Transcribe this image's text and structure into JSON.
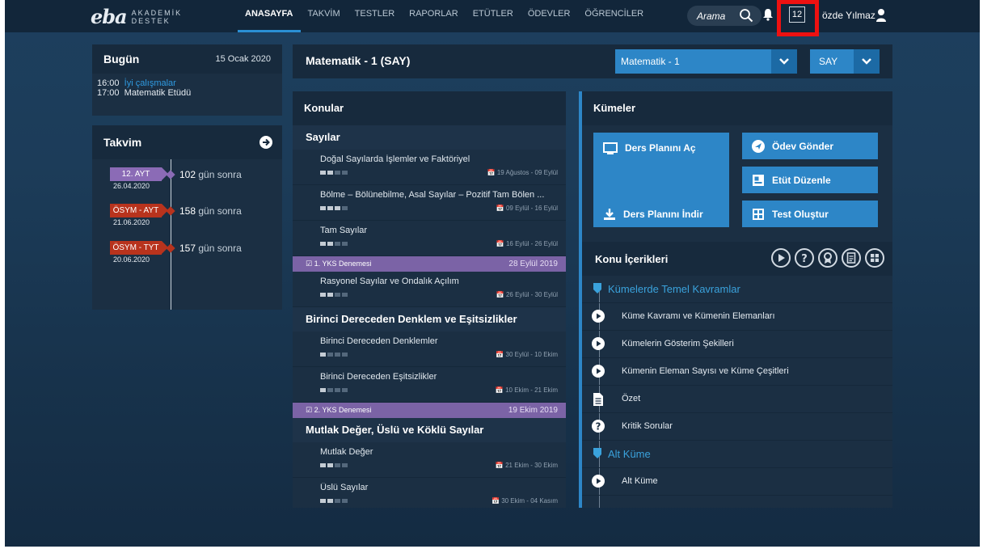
{
  "brand": {
    "mark": "eba",
    "line1": "AKADEMİK",
    "line2": "DESTEK"
  },
  "nav": [
    {
      "label": "ANASAYFA",
      "active": true
    },
    {
      "label": "TAKVİM"
    },
    {
      "label": "TESTLER"
    },
    {
      "label": "RAPORLAR"
    },
    {
      "label": "ETÜTLER"
    },
    {
      "label": "ÖDEVLER"
    },
    {
      "label": "ÖĞRENCİLER"
    }
  ],
  "search": {
    "placeholder": "Arama"
  },
  "header": {
    "message_count": "12",
    "user_name": "özde Yılmaz"
  },
  "today": {
    "title": "Bugün",
    "date": "15 Ocak 2020",
    "events": [
      {
        "time": "16:00",
        "text": "İyi çalışmalar"
      },
      {
        "time": "17:00",
        "text": "Matematik Etüdü"
      }
    ]
  },
  "calendar": {
    "title": "Takvim",
    "items": [
      {
        "label": "12. AYT",
        "date": "26.04.2020",
        "count": "102",
        "suffix": "gün sonra",
        "color": "#8b6bb6"
      },
      {
        "label": "ÖSYM - AYT",
        "date": "21.06.2020",
        "count": "158",
        "suffix": "gün sonra",
        "color": "#b8331d"
      },
      {
        "label": "ÖSYM - TYT",
        "date": "20.06.2020",
        "count": "157",
        "suffix": "gün sonra",
        "color": "#b8331d"
      }
    ]
  },
  "course": {
    "title": "Matematik - 1 (SAY)",
    "select_course": "Matematik - 1",
    "select_track": "SAY"
  },
  "topics": {
    "title": "Konular",
    "sections": [
      {
        "title": "Sayılar",
        "items": [
          {
            "title": "Doğal Sayılarda İşlemler ve Faktöriyel",
            "range": "19 Ağustos - 09 Eylül",
            "progress": 2
          },
          {
            "title": "Bölme – Bölünebilme, Asal Sayılar – Pozitif Tam Bölen ...",
            "range": "09 Eylül - 16 Eylül",
            "progress": 3
          },
          {
            "title": "Tam Sayılar",
            "range": "16 Eylül - 26 Eylül",
            "progress": 2
          }
        ]
      },
      {
        "exam": {
          "label": "1. YKS Denemesi",
          "date": "28 Eylül 2019"
        }
      },
      {
        "items": [
          {
            "title": "Rasyonel Sayılar ve Ondalık Açılım",
            "range": "26 Eylül - 30 Eylül",
            "progress": 2
          }
        ]
      },
      {
        "title": "Birinci Dereceden Denklem ve Eşitsizlikler",
        "items": [
          {
            "title": "Birinci Dereceden Denklemler",
            "range": "30 Eylül - 10 Ekim",
            "progress": 1
          },
          {
            "title": "Birinci Dereceden Eşitsizlikler",
            "range": "10 Ekim - 21 Ekim",
            "progress": 1
          }
        ]
      },
      {
        "exam": {
          "label": "2. YKS Denemesi",
          "date": "19 Ekim 2019"
        }
      },
      {
        "title": "Mutlak Değer, Üslü ve Köklü Sayılar",
        "items": [
          {
            "title": "Mutlak Değer",
            "range": "21 Ekim - 30 Ekim",
            "progress": 2
          },
          {
            "title": "Üslü Sayılar",
            "range": "30 Ekim - 04 Kasım",
            "progress": 2
          }
        ]
      }
    ]
  },
  "clusters": {
    "title": "Kümeler",
    "buttons": {
      "open_plan": "Ders Planını Aç",
      "send_homework": "Ödev Gönder",
      "edit_study": "Etüt Düzenle",
      "download_plan": "Ders Planını İndir",
      "create_test": "Test Oluştur"
    },
    "content_title": "Konu İçerikleri",
    "content_icons": [
      "play-icon",
      "question-icon",
      "award-icon",
      "document-icon",
      "grid-icon"
    ],
    "contents": [
      {
        "type": "section",
        "text": "Kümelerde Temel Kavramlar"
      },
      {
        "type": "video",
        "text": "Küme Kavramı ve Kümenin Elemanları"
      },
      {
        "type": "video",
        "text": "Kümelerin Gösterim Şekilleri"
      },
      {
        "type": "video",
        "text": "Kümenin Eleman Sayısı ve Küme Çeşitleri"
      },
      {
        "type": "doc",
        "text": "Özet"
      },
      {
        "type": "question",
        "text": "Kritik Sorular"
      },
      {
        "type": "section",
        "text": "Alt Küme"
      },
      {
        "type": "video",
        "text": "Alt Küme"
      }
    ]
  }
}
